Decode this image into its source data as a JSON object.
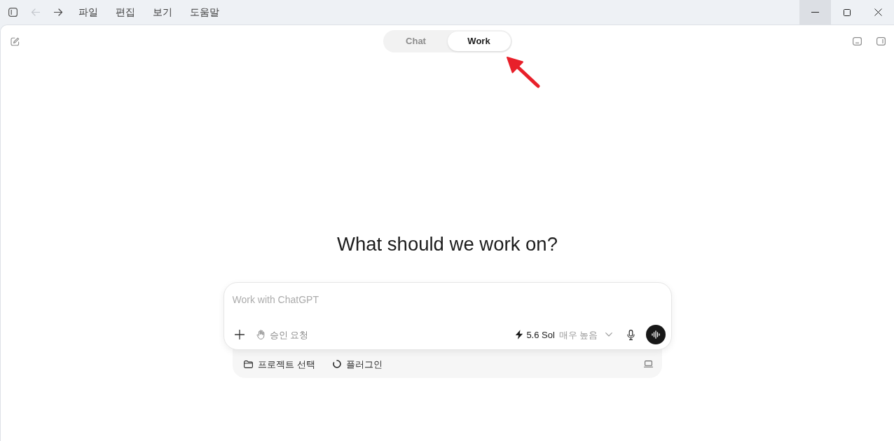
{
  "title_bar": {
    "nav": [
      {
        "kind": "back",
        "disabled": true
      },
      {
        "kind": "forward",
        "disabled": false
      }
    ],
    "menu": [
      "파일",
      "편집",
      "보기",
      "도움말"
    ],
    "window_controls": [
      {
        "kind": "minimize",
        "hovered": true
      },
      {
        "kind": "maximize",
        "hovered": false
      },
      {
        "kind": "close",
        "hovered": false
      }
    ]
  },
  "mode_tabs": [
    {
      "label": "Chat",
      "selected": false
    },
    {
      "label": "Work",
      "selected": true
    }
  ],
  "heading": "What should we work on?",
  "composer": {
    "placeholder": "Work with ChatGPT",
    "approval": "승인 요청",
    "model": {
      "name": "5.6 Sol",
      "effort": "매우 높음"
    }
  },
  "tray": {
    "items": [
      {
        "kind": "project",
        "label": "프로젝트 선택"
      },
      {
        "kind": "plugins",
        "label": "플러그인"
      }
    ]
  }
}
